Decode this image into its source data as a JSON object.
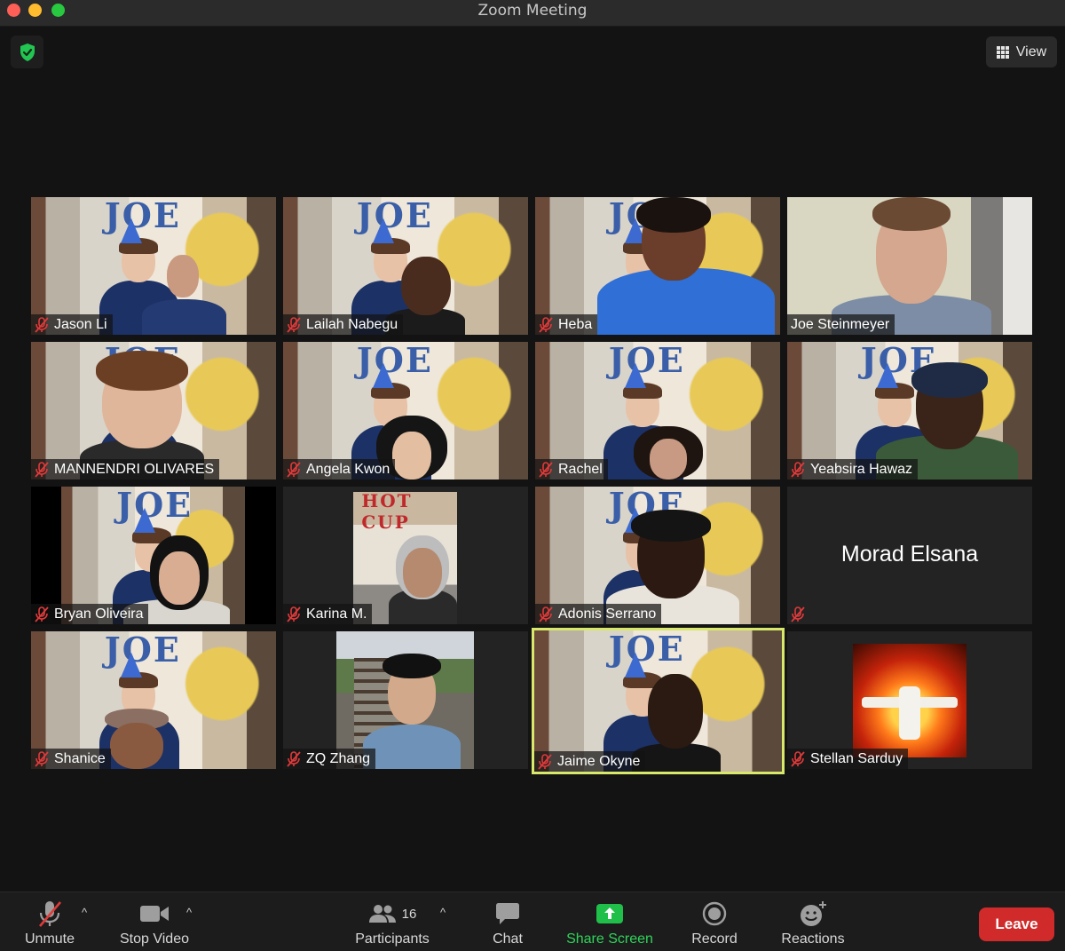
{
  "window": {
    "title": "Zoom Meeting"
  },
  "top": {
    "view_label": "View"
  },
  "participants": [
    {
      "name": "Jason Li"
    },
    {
      "name": "Lailah Nabegu"
    },
    {
      "name": "Heba"
    },
    {
      "name": "Joe Steinmeyer"
    },
    {
      "name": "MANNENDRI OLIVARES"
    },
    {
      "name": "Angela Kwon"
    },
    {
      "name": "Rachel"
    },
    {
      "name": "Yeabsira Hawaz"
    },
    {
      "name": "Bryan Oliveira"
    },
    {
      "name": "Karina M."
    },
    {
      "name": "Adonis Serrano"
    },
    {
      "name": "Morad Elsana"
    },
    {
      "name": "Shanice"
    },
    {
      "name": "ZQ Zhang"
    },
    {
      "name": "Jaime Okyne"
    },
    {
      "name": "Stellan Sarduy"
    }
  ],
  "toolbar": {
    "unmute": "Unmute",
    "stop_video": "Stop Video",
    "participants": "Participants",
    "participant_count": "16",
    "chat": "Chat",
    "share_screen": "Share Screen",
    "record": "Record",
    "reactions": "Reactions",
    "leave": "Leave"
  },
  "colors": {
    "active_speaker": "#d8e86a",
    "leave": "#d12a2a",
    "share": "#2fd45a",
    "mute": "#e03a3a"
  }
}
